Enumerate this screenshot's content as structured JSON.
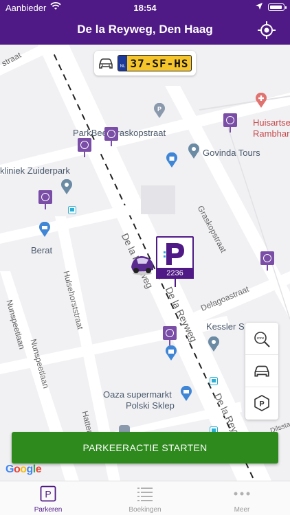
{
  "status_bar": {
    "carrier": "Aanbieder",
    "time": "18:54"
  },
  "header": {
    "title": "De la Reyweg, Den Haag"
  },
  "vehicle": {
    "plate": "37-SF-HS",
    "country": "NL"
  },
  "map": {
    "labels": {
      "parkbee": "ParkBee Graskopstraat",
      "govinda": "Govinda Tours",
      "zuiderpark": "kliniek Zuiderpark",
      "huisarts1": "Huisartse",
      "huisarts2": "Rambhar",
      "berat": "Berat",
      "kessler": "Kessler S",
      "oaza1": "Oaza supermarkt",
      "oaza2": "Polski Sklep"
    },
    "streets": {
      "reyweg1": "De la Reyweg",
      "reyweg2": "De la Reyweg",
      "reyweg3": "De la Reyweg",
      "graskop": "Graskopstraat",
      "delagoa": "Delagoastraat",
      "huls": "Hulsehorststraat",
      "nunspeet1": "Nunspeetlaan",
      "nunspeet2": "Nunspeetlaan",
      "hattem": "Hattem",
      "straat": "straat",
      "dilstaat": "Dilsstaat"
    },
    "selected_zone": "2236",
    "tools": [
      "zone-search",
      "car",
      "parking"
    ]
  },
  "actions": {
    "start_label": "PARKEERACTIE STARTEN"
  },
  "tabs": [
    {
      "label": "Parkeren",
      "active": true
    },
    {
      "label": "Boekingen",
      "active": false
    },
    {
      "label": "Meer",
      "active": false
    }
  ],
  "branding": {
    "google": [
      "G",
      "o",
      "o",
      "g",
      "l",
      "e"
    ]
  },
  "colors": {
    "primary": "#4f1a85",
    "accent": "#7a4da6",
    "start": "#2f8a1e",
    "plate": "#f5c52b"
  }
}
